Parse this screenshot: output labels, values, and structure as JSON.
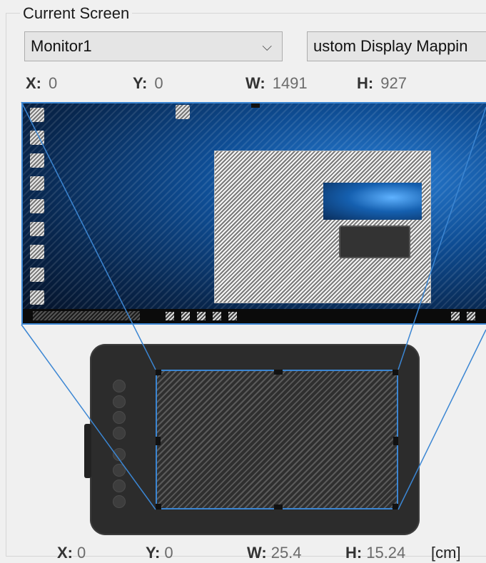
{
  "group": {
    "title": "Current Screen"
  },
  "monitor_select": {
    "value": "Monitor1"
  },
  "mapping_select": {
    "value": "ustom Display Mappin"
  },
  "screen_coords": {
    "x_label": "X:",
    "x": "0",
    "y_label": "Y:",
    "y": "0",
    "w_label": "W:",
    "w": "1491",
    "h_label": "H:",
    "h": "927"
  },
  "tablet_coords": {
    "x_label": "X:",
    "x": "0",
    "y_label": "Y:",
    "y": "0",
    "w_label": "W:",
    "w": "25.4",
    "h_label": "H:",
    "h": "15.24",
    "unit": "[cm]"
  },
  "icons": {
    "dropdown": "chevron-down-icon",
    "desktop_icon": "desktop-shortcut-icon"
  },
  "colors": {
    "mapping_line": "#3b86d3",
    "tablet_body": "#2c2c2c"
  }
}
